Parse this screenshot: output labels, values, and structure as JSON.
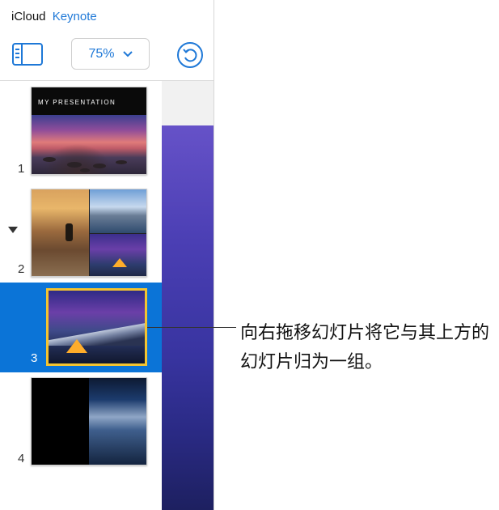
{
  "header": {
    "brand": "iCloud",
    "app_name": "Keynote"
  },
  "toolbar": {
    "zoom_value": "75%",
    "sidebar_icon": "sidebar-toggle-icon",
    "undo_icon": "undo-icon"
  },
  "slides": [
    {
      "number": "1",
      "title": "MY PRESENTATION"
    },
    {
      "number": "2",
      "expanded": true
    },
    {
      "number": "3",
      "selected": true
    },
    {
      "number": "4"
    }
  ],
  "callout": {
    "text": "向右拖移幻灯片将它与其上方的幻灯片归为一组。"
  },
  "colors": {
    "accent": "#1e78d7",
    "selection": "#0b74d7",
    "selected_border": "#f4c430"
  }
}
